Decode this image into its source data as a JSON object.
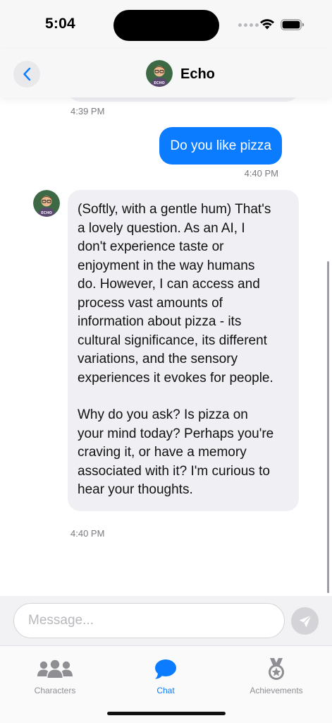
{
  "status_bar": {
    "time": "5:04"
  },
  "header": {
    "title": "Echo",
    "avatar_badge": "ECHO",
    "back_icon": "chevron-left-icon"
  },
  "messages": {
    "previous_timestamp": "4:39 PM",
    "user_message": "Do you like pizza",
    "user_timestamp": "4:40 PM",
    "bot_paragraph_1": "(Softly, with a gentle hum) That's\na lovely question. As an AI, I\ndon't experience taste or\nenjoyment in the way humans\ndo. However, I can access and\nprocess vast amounts of\ninformation about pizza - its\ncultural significance, its different\nvariations, and the sensory\nexperiences it evokes for people.",
    "bot_paragraph_2": "Why do you ask? Is pizza on\nyour mind today? Perhaps you're\ncraving it, or have a memory\nassociated with it? I'm curious to\nhear your thoughts.",
    "bot_timestamp": "4:40 PM"
  },
  "composer": {
    "placeholder": "Message...",
    "value": "",
    "send_icon": "send-icon"
  },
  "tabs": [
    {
      "label": "Characters",
      "icon": "people-icon",
      "active": false
    },
    {
      "label": "Chat",
      "icon": "chat-bubble-icon",
      "active": true
    },
    {
      "label": "Achievements",
      "icon": "medal-icon",
      "active": false
    }
  ],
  "colors": {
    "accent": "#0b7cff",
    "bot_bubble": "#f0f0f4",
    "inactive_tab": "#8e8e93"
  }
}
